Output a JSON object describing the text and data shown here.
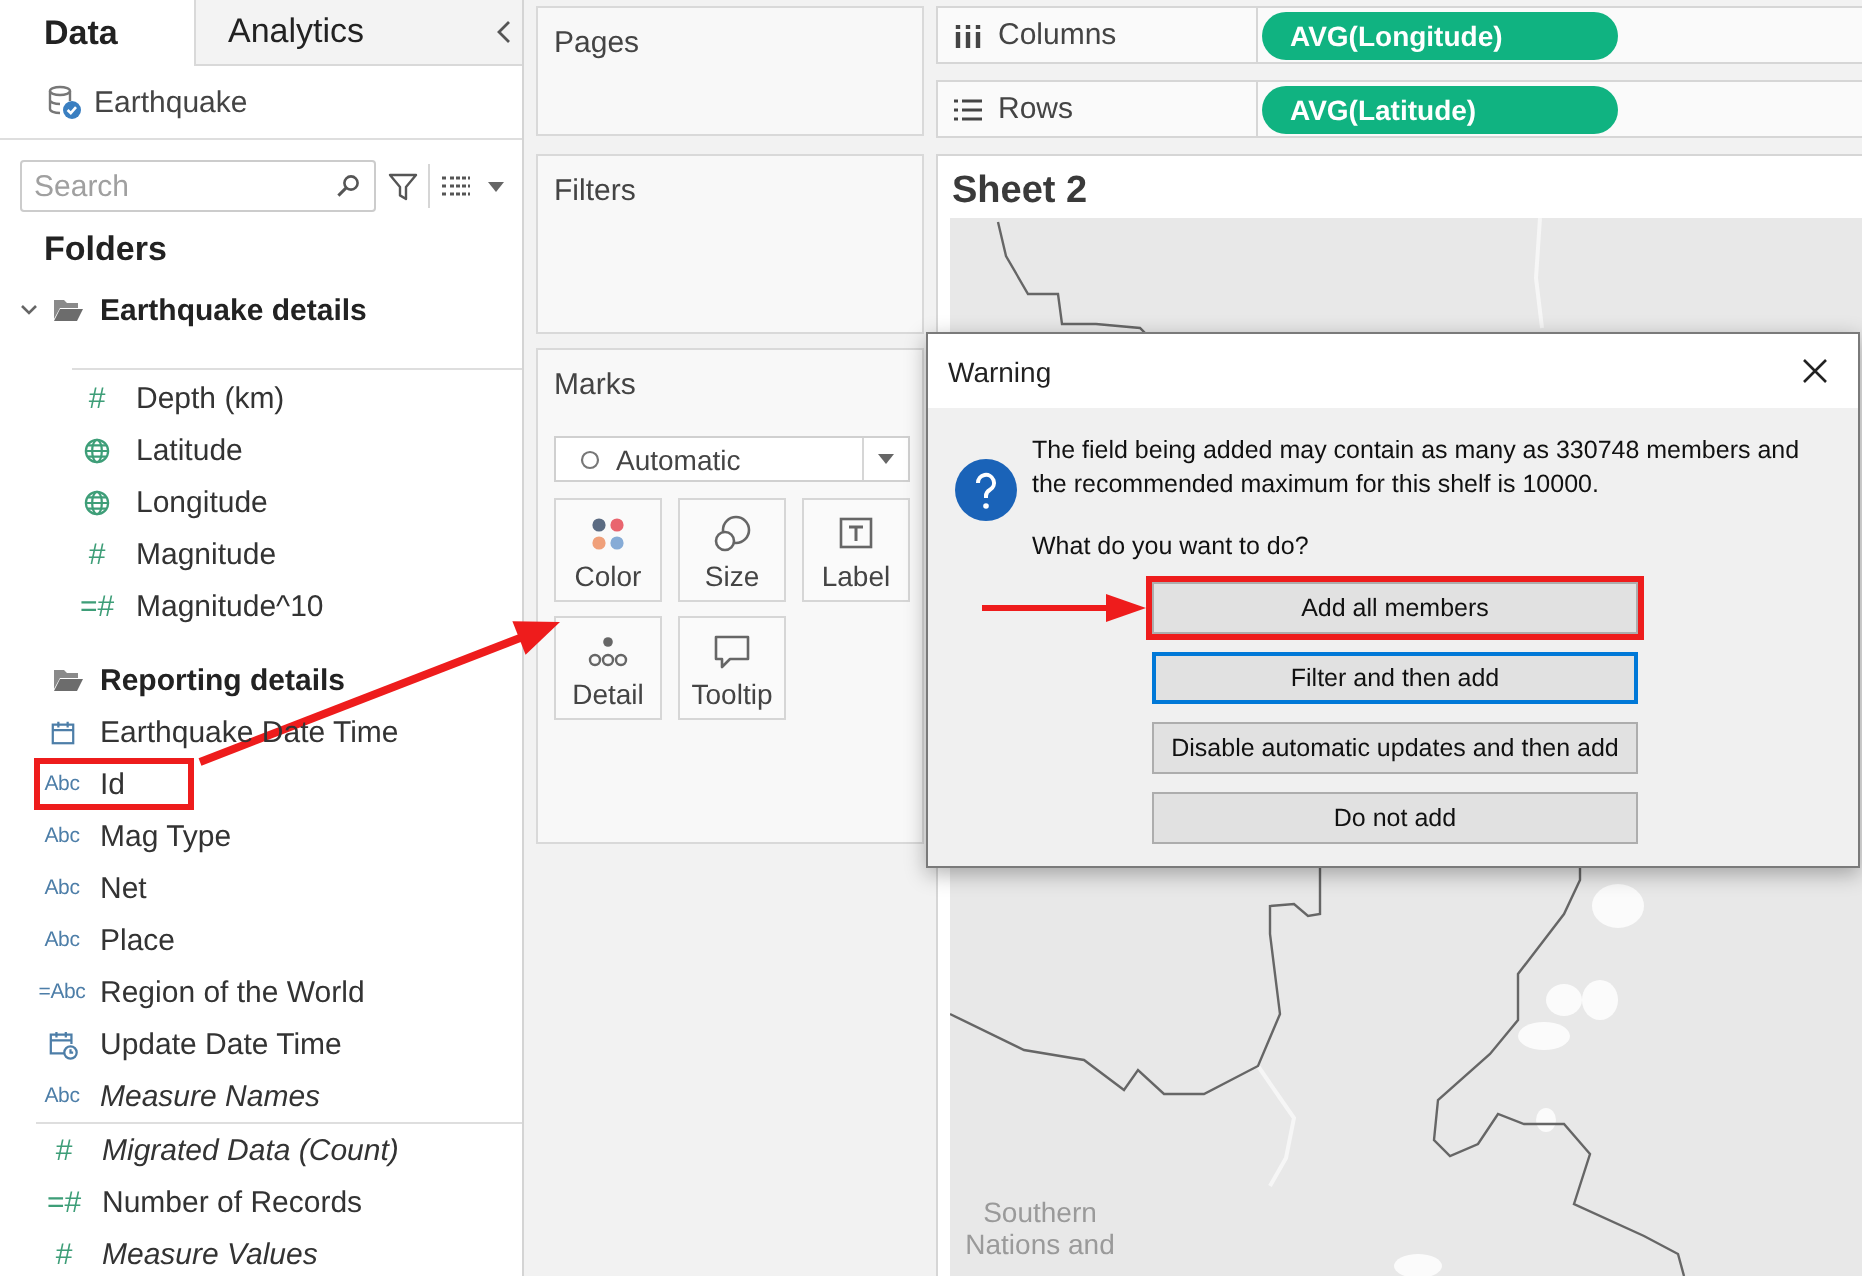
{
  "sidebar": {
    "tabs": [
      {
        "label": "Data",
        "selected": true
      },
      {
        "label": "Analytics",
        "selected": false
      }
    ],
    "datasource": "Earthquake",
    "search": {
      "placeholder": "Search"
    },
    "folders_heading": "Folders",
    "folders": [
      {
        "name": "Earthquake details",
        "expanded": true,
        "fields": [
          {
            "name": "Depth (km)",
            "kind": "glyph",
            "type_label": "#",
            "color": "#3e9e78",
            "generated": false,
            "highlighted": false
          },
          {
            "name": "Latitude",
            "kind": "globe",
            "color": "#3e9e78",
            "generated": false,
            "highlighted": false
          },
          {
            "name": "Longitude",
            "kind": "globe",
            "color": "#3e9e78",
            "generated": false,
            "highlighted": false
          },
          {
            "name": "Magnitude",
            "kind": "glyph",
            "type_label": "#",
            "color": "#3e9e78",
            "generated": false,
            "highlighted": false
          },
          {
            "name": "Magnitude^10",
            "kind": "glyph",
            "type_label": "=#",
            "color": "#3e9e78",
            "generated": false,
            "highlighted": false
          }
        ]
      },
      {
        "name": "Reporting details",
        "fields": [
          {
            "name": "Earthquake Date Time",
            "kind": "calendar",
            "color": "#4d7ea8",
            "generated": false,
            "highlighted": false
          },
          {
            "name": "Id",
            "kind": "glyph",
            "type_label": "Abc",
            "color": "#4d7ea8",
            "generated": false,
            "highlighted": true
          },
          {
            "name": "Mag Type",
            "kind": "glyph",
            "type_label": "Abc",
            "color": "#4d7ea8",
            "generated": false,
            "highlighted": false
          },
          {
            "name": "Net",
            "kind": "glyph",
            "type_label": "Abc",
            "color": "#4d7ea8",
            "generated": false,
            "highlighted": false
          },
          {
            "name": "Place",
            "kind": "glyph",
            "type_label": "Abc",
            "color": "#4d7ea8",
            "generated": false,
            "highlighted": false
          },
          {
            "name": "Region of the World",
            "kind": "glyph",
            "type_label": "=Abc",
            "color": "#4d7ea8",
            "generated": false,
            "highlighted": false
          },
          {
            "name": "Update Date Time",
            "kind": "calendar-clock",
            "color": "#4d7ea8",
            "generated": false,
            "highlighted": false
          },
          {
            "name": "Measure Names",
            "kind": "glyph",
            "type_label": "Abc",
            "color": "#4d7ea8",
            "generated": true,
            "highlighted": false
          }
        ]
      }
    ],
    "measures": [
      {
        "name": "Migrated Data (Count)",
        "kind": "glyph",
        "type_label": "#",
        "color": "#3e9e78",
        "generated": true,
        "highlighted": false
      },
      {
        "name": "Number of Records",
        "kind": "glyph",
        "type_label": "=#",
        "color": "#3e9e78",
        "generated": false,
        "highlighted": false
      },
      {
        "name": "Measure Values",
        "kind": "glyph",
        "type_label": "#",
        "color": "#3e9e78",
        "generated": true,
        "highlighted": false
      }
    ]
  },
  "cards": {
    "pages": {
      "title": "Pages"
    },
    "filters": {
      "title": "Filters"
    },
    "marks": {
      "title": "Marks",
      "mark_type": "Automatic",
      "buttons": [
        {
          "kind": "color",
          "label": "Color"
        },
        {
          "kind": "size",
          "label": "Size"
        },
        {
          "kind": "label",
          "label": "Label"
        },
        {
          "kind": "detail",
          "label": "Detail"
        },
        {
          "kind": "tooltip",
          "label": "Tooltip"
        }
      ]
    }
  },
  "shelves": [
    {
      "kind": "columns",
      "label": "Columns",
      "pills": [
        "AVG(Longitude)"
      ]
    },
    {
      "kind": "rows",
      "label": "Rows",
      "pills": [
        "AVG(Latitude)"
      ]
    }
  ],
  "sheet": {
    "title": "Sheet 2",
    "map_label": "Southern Nations and"
  },
  "dialog": {
    "title": "Warning",
    "message_lines": [
      "The field being added may contain as many as 330748 members and",
      "the recommended maximum for this shelf is 10000."
    ],
    "question": "What do you want to do?",
    "buttons": [
      {
        "label": "Add all members",
        "focused": false,
        "highlighted": true
      },
      {
        "label": "Filter and then add",
        "focused": true,
        "highlighted": false
      },
      {
        "label": "Disable automatic updates and then add",
        "focused": false,
        "highlighted": false
      },
      {
        "label": "Do not add",
        "focused": false,
        "highlighted": false
      }
    ]
  }
}
